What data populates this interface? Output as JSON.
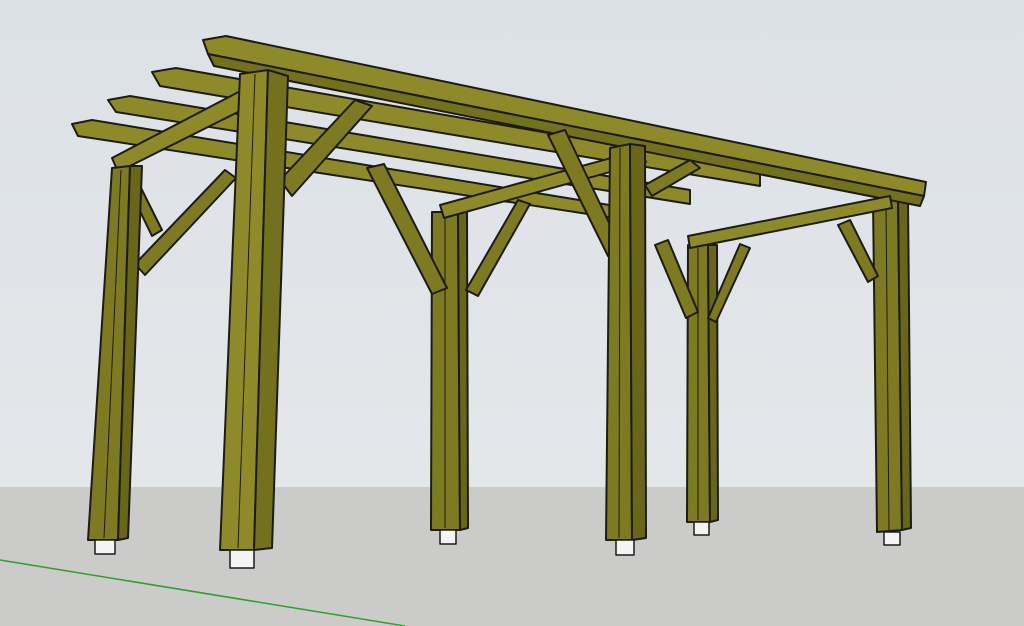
{
  "scene": {
    "subject": "",
    "colors": {
      "sky": "#dfe3e7",
      "ground": "#cbcbca",
      "timber_light": "#8e8a2a",
      "timber_mid": "#7d7a22",
      "timber_dark": "#69661a",
      "outline": "#1c1c14",
      "footing": "#f4f4f4",
      "green_axis": "#2ca02c"
    },
    "posts": 6,
    "rafters": 4,
    "icons": [
      "green-axis-line-icon"
    ]
  }
}
